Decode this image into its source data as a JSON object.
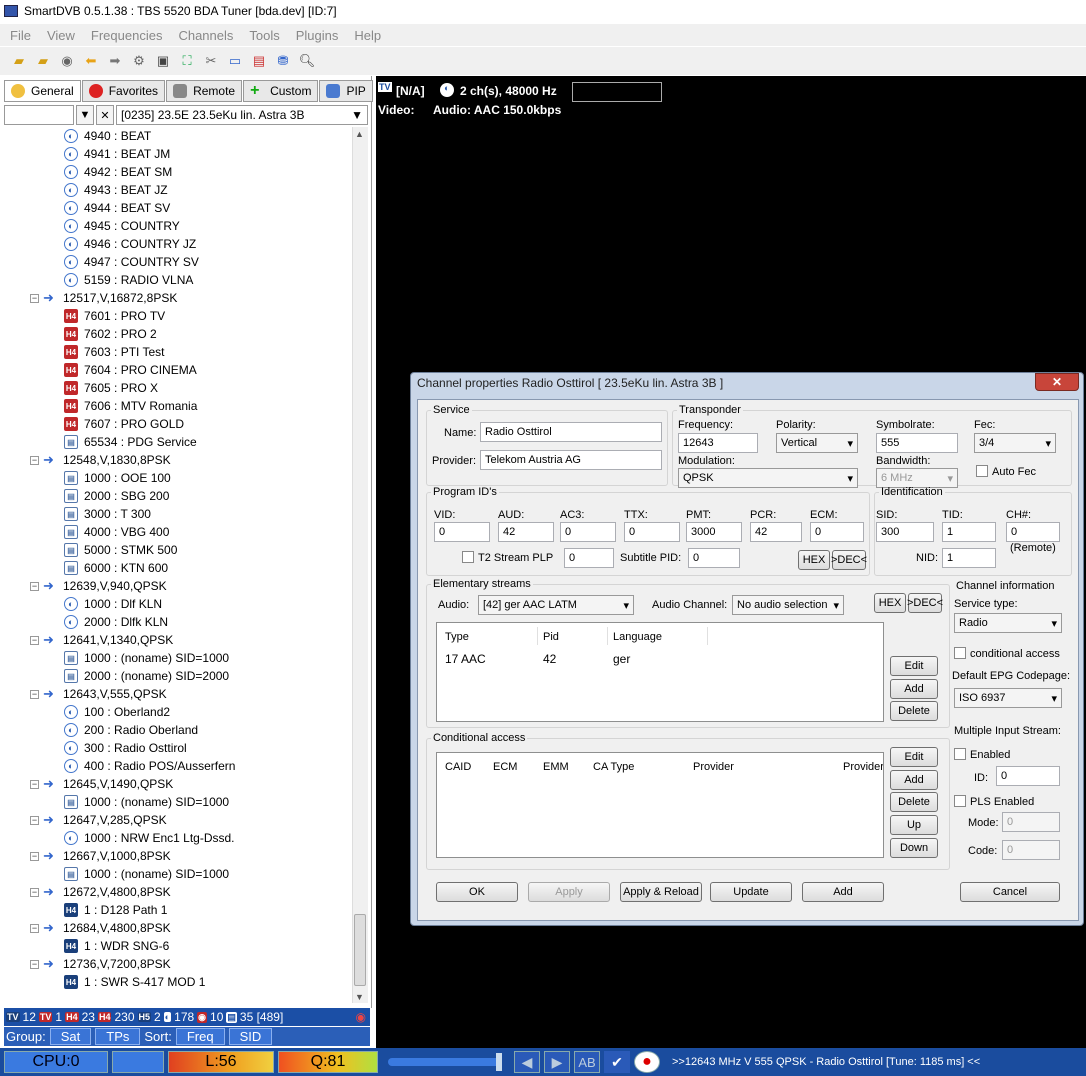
{
  "window": {
    "title": "SmartDVB 0.5.1.38 : TBS 5520 BDA Tuner [bda.dev]  [ID:7]"
  },
  "menu": [
    "File",
    "View",
    "Frequencies",
    "Channels",
    "Tools",
    "Plugins",
    "Help"
  ],
  "tabs": [
    "General",
    "Favorites",
    "Remote",
    "Custom",
    "PIP"
  ],
  "satellite": "[0235] 23.5E  23.5eKu lin. Astra 3B",
  "tree": [
    {
      "t": "ch",
      "icon": "radio",
      "label": "4940 : BEAT"
    },
    {
      "t": "ch",
      "icon": "radio",
      "label": "4941 : BEAT JM"
    },
    {
      "t": "ch",
      "icon": "radio",
      "label": "4942 : BEAT SM"
    },
    {
      "t": "ch",
      "icon": "radio",
      "label": "4943 : BEAT JZ"
    },
    {
      "t": "ch",
      "icon": "radio",
      "label": "4944 : BEAT SV"
    },
    {
      "t": "ch",
      "icon": "radio",
      "label": "4945 : COUNTRY"
    },
    {
      "t": "ch",
      "icon": "radio",
      "label": "4946 : COUNTRY JZ"
    },
    {
      "t": "ch",
      "icon": "radio",
      "label": "4947 : COUNTRY SV"
    },
    {
      "t": "ch",
      "icon": "radio",
      "label": "5159 : RADIO VLNA"
    },
    {
      "t": "tp",
      "label": "12517,V,16872,8PSK"
    },
    {
      "t": "ch",
      "icon": "hd4",
      "label": "7601 : PRO TV"
    },
    {
      "t": "ch",
      "icon": "hd4",
      "label": "7602 : PRO 2"
    },
    {
      "t": "ch",
      "icon": "hd4",
      "label": "7603 : PTI Test"
    },
    {
      "t": "ch",
      "icon": "hd4",
      "label": "7604 : PRO CINEMA"
    },
    {
      "t": "ch",
      "icon": "hd4",
      "label": "7605 : PRO X"
    },
    {
      "t": "ch",
      "icon": "hd4",
      "label": "7606 : MTV Romania"
    },
    {
      "t": "ch",
      "icon": "hd4",
      "label": "7607 : PRO GOLD"
    },
    {
      "t": "ch",
      "icon": "sd",
      "label": "65534 : PDG Service"
    },
    {
      "t": "tp",
      "label": "12548,V,1830,8PSK"
    },
    {
      "t": "ch",
      "icon": "sd",
      "label": "1000 : OOE 100"
    },
    {
      "t": "ch",
      "icon": "sd",
      "label": "2000 : SBG 200"
    },
    {
      "t": "ch",
      "icon": "sd",
      "label": "3000 : T 300"
    },
    {
      "t": "ch",
      "icon": "sd",
      "label": "4000 : VBG 400"
    },
    {
      "t": "ch",
      "icon": "sd",
      "label": "5000 : STMK 500"
    },
    {
      "t": "ch",
      "icon": "sd",
      "label": "6000 : KTN 600"
    },
    {
      "t": "tp",
      "label": "12639,V,940,QPSK"
    },
    {
      "t": "ch",
      "icon": "radio",
      "label": "1000 : Dlf KLN"
    },
    {
      "t": "ch",
      "icon": "radio",
      "label": "2000 : Dlfk KLN"
    },
    {
      "t": "tp",
      "label": "12641,V,1340,QPSK"
    },
    {
      "t": "ch",
      "icon": "sd",
      "label": "1000 : (noname) SID=1000"
    },
    {
      "t": "ch",
      "icon": "sd",
      "label": "2000 : (noname) SID=2000"
    },
    {
      "t": "tp",
      "label": "12643,V,555,QPSK"
    },
    {
      "t": "ch",
      "icon": "radio",
      "label": "100 : Oberland2"
    },
    {
      "t": "ch",
      "icon": "radio",
      "label": "200 : Radio Oberland"
    },
    {
      "t": "ch",
      "icon": "radio",
      "label": "300 : Radio Osttirol"
    },
    {
      "t": "ch",
      "icon": "radio",
      "label": "400 : Radio POS/Ausserfern"
    },
    {
      "t": "tp",
      "label": "12645,V,1490,QPSK"
    },
    {
      "t": "ch",
      "icon": "sd",
      "label": "1000 : (noname) SID=1000"
    },
    {
      "t": "tp",
      "label": "12647,V,285,QPSK"
    },
    {
      "t": "ch",
      "icon": "radio",
      "label": "1000 : NRW Enc1 Ltg-Dssd."
    },
    {
      "t": "tp",
      "label": "12667,V,1000,8PSK"
    },
    {
      "t": "ch",
      "icon": "sd",
      "label": "1000 : (noname) SID=1000"
    },
    {
      "t": "tp",
      "label": "12672,V,4800,8PSK"
    },
    {
      "t": "ch",
      "icon": "hdb",
      "label": "1 : D128 Path 1"
    },
    {
      "t": "tp",
      "label": "12684,V,4800,8PSK"
    },
    {
      "t": "ch",
      "icon": "hdb",
      "label": "1 : WDR SNG-6"
    },
    {
      "t": "tp",
      "label": "12736,V,7200,8PSK"
    },
    {
      "t": "ch",
      "icon": "hdb",
      "label": "1 : SWR S-417 MOD 1"
    }
  ],
  "counts": [
    {
      "b": "TV",
      "v": "12"
    },
    {
      "b": "TV",
      "v": "1"
    },
    {
      "b": "H4",
      "v": "23"
    },
    {
      "b": "H4",
      "v": "230"
    },
    {
      "b": "H5",
      "v": "2"
    },
    {
      "b": "radio",
      "v": "178"
    },
    {
      "b": "enc",
      "v": "10"
    },
    {
      "b": "sd",
      "v": "35 [489]"
    }
  ],
  "group": {
    "label": "Group:",
    "buttons": [
      "Sat",
      "TPs"
    ],
    "sort_label": "Sort:",
    "sort_buttons": [
      "Freq",
      "SID"
    ]
  },
  "status": {
    "cpu": "CPU:0",
    "l": "L:56",
    "q": "Q:81",
    "tune": ">>12643 MHz V 555 QPSK - Radio Osttirol [Tune: 1185 ms] <<",
    "ab": "AB"
  },
  "info": {
    "tv": "TV",
    "na": "[N/A]",
    "audio_ch": "2 ch(s), 48000 Hz",
    "video": "Video:",
    "audio": "Audio: AAC  150.0kbps"
  },
  "dialog": {
    "title": "Channel properties Radio Osttirol [ 23.5eKu lin. Astra 3B ]",
    "service": {
      "legend": "Service",
      "name_label": "Name:",
      "name": "Radio Osttirol",
      "provider_label": "Provider:",
      "provider": "Telekom Austria AG"
    },
    "transponder": {
      "legend": "Transponder",
      "freq_label": "Frequency:",
      "freq": "12643",
      "pol_label": "Polarity:",
      "pol": "Vertical",
      "sr_label": "Symbolrate:",
      "sr": "555",
      "fec_label": "Fec:",
      "fec": "3/4",
      "mod_label": "Modulation:",
      "mod": "QPSK",
      "bw_label": "Bandwidth:",
      "bw": "6 MHz",
      "autofec": "Auto Fec"
    },
    "pids": {
      "legend": "Program ID's",
      "vid_l": "VID:",
      "vid": "0",
      "aud_l": "AUD:",
      "aud": "42",
      "ac3_l": "AC3:",
      "ac3": "0",
      "ttx_l": "TTX:",
      "ttx": "0",
      "pmt_l": "PMT:",
      "pmt": "3000",
      "pcr_l": "PCR:",
      "pcr": "42",
      "ecm_l": "ECM:",
      "ecm": "0",
      "t2": "T2 Stream PLP",
      "t2v": "0",
      "sub_l": "Subtitle PID:",
      "sub": "0",
      "hex": "HEX",
      "dec": ">DEC<"
    },
    "ident": {
      "legend": "Identification",
      "sid_l": "SID:",
      "sid": "300",
      "tid_l": "TID:",
      "tid": "1",
      "ch_l": "CH#:",
      "ch": "0",
      "nid_l": "NID:",
      "nid": "1",
      "remote": "(Remote)"
    },
    "es": {
      "legend": "Elementary streams",
      "audio_l": "Audio:",
      "audio": "[42] ger AAC LATM",
      "ach_l": "Audio Channel:",
      "ach": "No audio selection",
      "hex": "HEX",
      "dec": ">DEC<",
      "cols": [
        "Type",
        "Pid",
        "Language"
      ],
      "row": [
        "17 AAC",
        "42",
        "ger"
      ],
      "edit": "Edit",
      "add": "Add",
      "delete": "Delete"
    },
    "ca": {
      "legend": "Conditional access",
      "cols": [
        "CAID",
        "ECM",
        "EMM",
        "CA Type",
        "Provider",
        "Provider"
      ],
      "edit": "Edit",
      "add": "Add",
      "delete": "Delete",
      "up": "Up",
      "down": "Down"
    },
    "chinfo": {
      "legend": "Channel information",
      "stype_l": "Service type:",
      "stype": "Radio",
      "cond": "conditional access",
      "epg_l": "Default EPG Codepage:",
      "epg": "ISO 6937",
      "mis": "Multiple Input Stream:",
      "enabled": "Enabled",
      "id_l": "ID:",
      "id": "0",
      "pls": "PLS Enabled",
      "mode_l": "Mode:",
      "mode": "0",
      "code_l": "Code:",
      "code": "0"
    },
    "buttons": {
      "ok": "OK",
      "apply": "Apply",
      "reload": "Apply & Reload",
      "update": "Update",
      "add": "Add",
      "cancel": "Cancel"
    }
  }
}
